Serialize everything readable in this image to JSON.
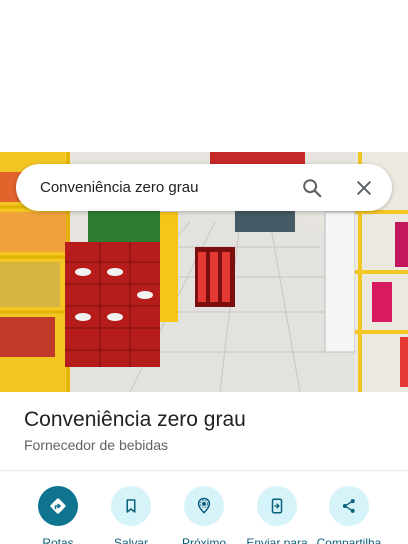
{
  "search": {
    "query": "Conveniência zero grau"
  },
  "icons": {
    "search": "search-icon",
    "close": "close-icon",
    "directions": "directions-icon",
    "save": "bookmark-icon",
    "nearby": "nearby-icon",
    "send": "send-to-phone-icon",
    "share": "share-icon"
  },
  "place": {
    "name": "Conveniência zero grau",
    "category": "Fornecedor de bebidas"
  },
  "actions": [
    {
      "label": "Rotas"
    },
    {
      "label": "Salvar"
    },
    {
      "label": "Próximo"
    },
    {
      "label": "Enviar para"
    },
    {
      "label": "Compartilha"
    }
  ],
  "colors": {
    "primary_action": "#0e7490",
    "action_bg": "#d7f3fa",
    "action_text": "#0b5f7a"
  }
}
